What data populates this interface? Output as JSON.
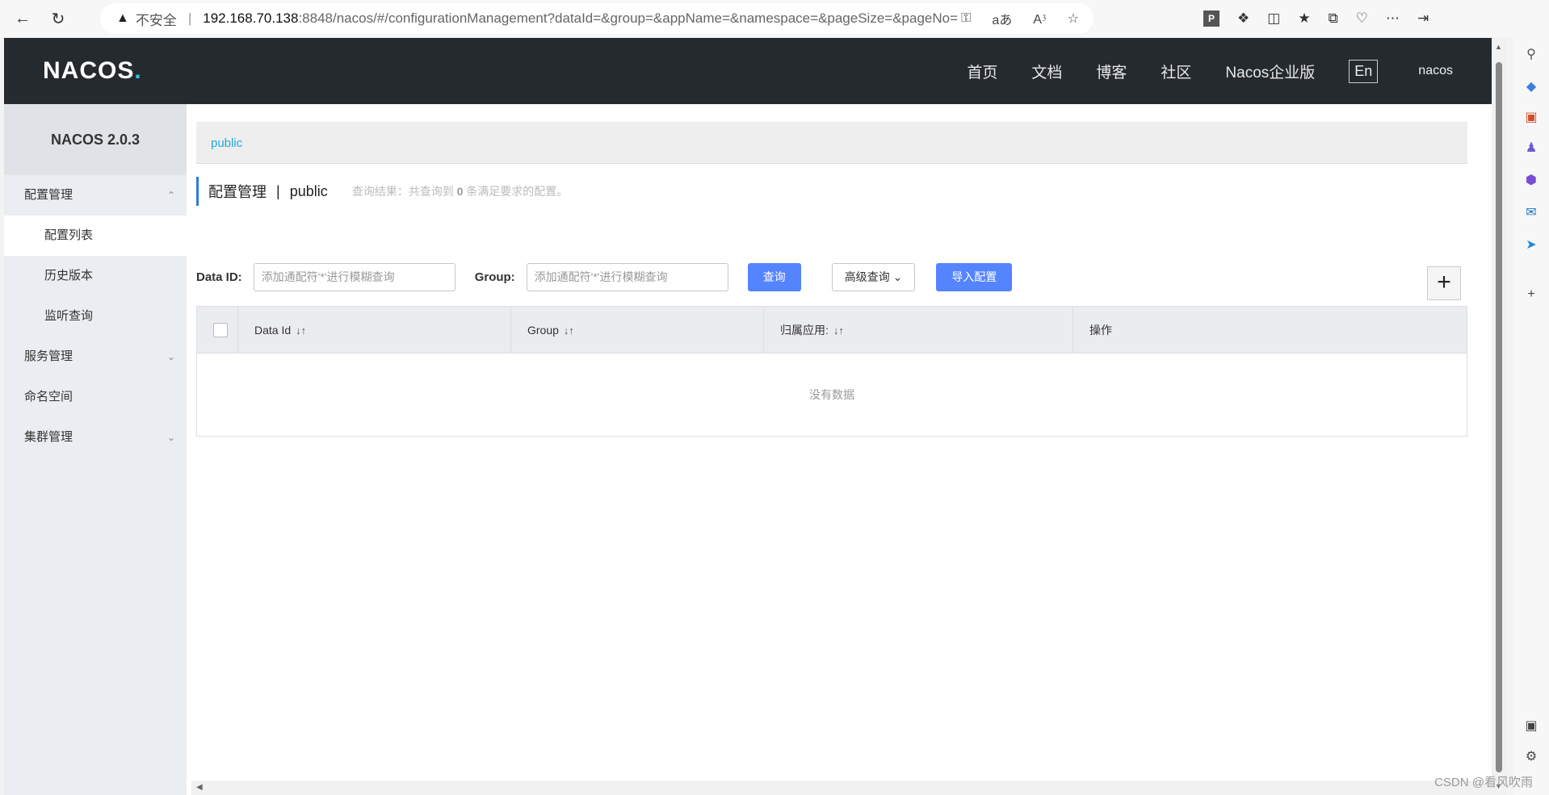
{
  "browser": {
    "back_icon": "arrow-left-icon",
    "refresh_icon": "refresh-icon",
    "insecure_label": "不安全",
    "separator": "|",
    "url_host": "192.168.70.138",
    "url_rest": ":8848/nacos/#/configurationManagement?dataId=&group=&appName=&namespace=&pageSize=&pageNo=",
    "extension_label": "P"
  },
  "header": {
    "logo": "NACOS",
    "logo_dot": ".",
    "links": [
      "首页",
      "文档",
      "博客",
      "社区",
      "Nacos企业版"
    ],
    "lang_button": "En",
    "user": "nacos"
  },
  "sidebar": {
    "version": "NACOS 2.0.3",
    "config_group": "配置管理",
    "config_items": [
      "配置列表",
      "历史版本",
      "监听查询"
    ],
    "service_group": "服务管理",
    "namespace": "命名空间",
    "cluster_group": "集群管理"
  },
  "main": {
    "namespace_tab": "public",
    "title": "配置管理",
    "title_sep": "|",
    "title_ns": "public",
    "result_prefix": "查询结果：共查询到",
    "result_count": "0",
    "result_suffix": "条满足要求的配置。",
    "dataid_label": "Data ID:",
    "dataid_placeholder": "添加通配符'*'进行模糊查询",
    "group_label": "Group:",
    "group_placeholder": "添加通配符'*'进行模糊查询",
    "query_button": "查询",
    "advanced_button": "高级查询",
    "import_button": "导入配置",
    "add_button": "+"
  },
  "table": {
    "columns": [
      "Data Id",
      "Group",
      "归属应用:",
      "操作"
    ],
    "sort_icon": "↓↑",
    "empty_text": "没有数据"
  },
  "watermark": "CSDN @看风吹雨"
}
